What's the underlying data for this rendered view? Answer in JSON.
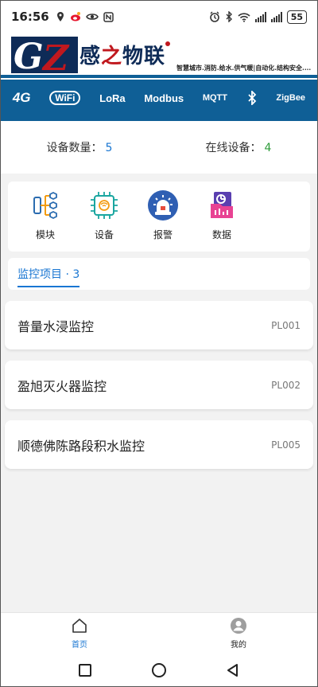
{
  "status_bar": {
    "time": "16:56",
    "battery": "55",
    "left_icons": [
      "location-icon",
      "weibo-icon",
      "eye-icon",
      "nfc-icon"
    ],
    "right_icons": [
      "alarm-icon",
      "bluetooth-icon",
      "wifi-icon",
      "signal-icon",
      "signal-icon",
      "battery-icon"
    ]
  },
  "banner": {
    "logo_letters": "GZ",
    "brand_name": "感之物联",
    "brand_name_parts": [
      "感",
      "之",
      "物联"
    ],
    "tagline": "智慧城市.消防.给水.供气暖|自动化.结构安全....",
    "protocols": [
      "4G",
      "WiFi",
      "LoRa",
      "Modbus",
      "MQTT",
      "ZigBee"
    ],
    "colors": {
      "band": "#0f5f96",
      "navy": "#0e2b57",
      "red": "#c0181e"
    }
  },
  "stats": {
    "device_count_label": "设备数量：",
    "device_count": "5",
    "online_label": "在线设备：",
    "online_count": "4"
  },
  "menu": {
    "items": [
      {
        "label": "模块",
        "icon": "module-icon"
      },
      {
        "label": "设备",
        "icon": "chip-icon"
      },
      {
        "label": "报警",
        "icon": "alarm-siren-icon"
      },
      {
        "label": "数据",
        "icon": "data-folder-icon"
      }
    ]
  },
  "section": {
    "title": "监控项目 · 3"
  },
  "monitor_list": [
    {
      "name": "普量水浸监控",
      "code": "PL001"
    },
    {
      "name": "盈旭灭火器监控",
      "code": "PL002"
    },
    {
      "name": "顺德佛陈路段积水监控",
      "code": "PL005"
    }
  ],
  "tabbar": {
    "tabs": [
      {
        "label": "首页",
        "icon": "home-icon",
        "active": true
      },
      {
        "label": "我的",
        "icon": "user-avatar-icon",
        "active": false
      }
    ],
    "active_color": "#1976d2"
  }
}
